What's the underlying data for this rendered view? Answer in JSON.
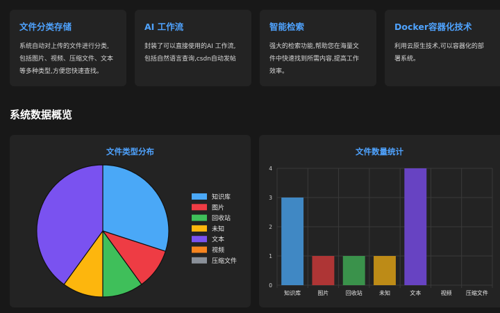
{
  "features": [
    {
      "title": "文件分类存储",
      "lines": [
        "系统自动对上传的文件进行分类,",
        "包括图片、视频、压缩文件、文本",
        "等多种类型,方便您快速查找。"
      ]
    },
    {
      "title": "AI 工作流",
      "lines": [
        "封装了可以直接使用的AI 工作流,",
        "包括自然语言查询,csdn自动发帖"
      ]
    },
    {
      "title": "智能检索",
      "lines": [
        "强大的检索功能,帮助您在海量文",
        "件中快速找到所需内容,提高工作",
        "效率。"
      ]
    },
    {
      "title": "Docker容器化技术",
      "lines": [
        "利用云原生技术,可以容器化的部",
        "署系统。"
      ]
    }
  ],
  "section_title": "系统数据概览",
  "pie_panel_title": "文件类型分布",
  "bar_panel_title": "文件数量统计",
  "chart_data": [
    {
      "type": "pie",
      "title": "文件类型分布",
      "categories": [
        "知识库",
        "图片",
        "回收站",
        "未知",
        "文本",
        "视频",
        "压缩文件"
      ],
      "values": [
        3,
        1,
        1,
        1,
        4,
        0,
        0
      ],
      "colors": [
        "#4aa8f7",
        "#ee3c44",
        "#3fbf5a",
        "#fdb60d",
        "#7a52f0",
        "#f7841e",
        "#8a9099"
      ],
      "legend": "right"
    },
    {
      "type": "bar",
      "title": "文件数量统计",
      "categories": [
        "知识库",
        "图片",
        "回收站",
        "未知",
        "文本",
        "视频",
        "压缩文件"
      ],
      "values": [
        3,
        1,
        1,
        1,
        4,
        0,
        0
      ],
      "colors": [
        "#4088c4",
        "#ae3535",
        "#3a924b",
        "#bd8b17",
        "#6743c2",
        "#f7841e",
        "#8a9099"
      ],
      "ylim": [
        0,
        4
      ],
      "yticks": [
        "0",
        "1",
        "2",
        "3",
        "4"
      ],
      "grid": true
    }
  ]
}
